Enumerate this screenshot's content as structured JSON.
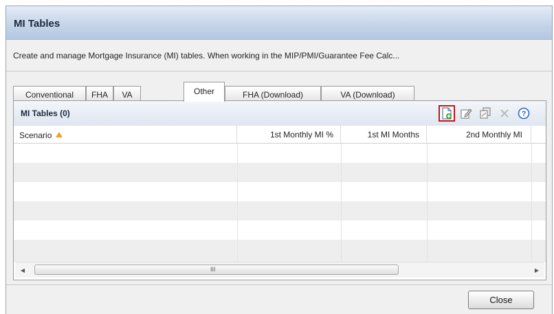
{
  "window": {
    "title": "MI Tables",
    "description": "Create and manage Mortgage Insurance (MI) tables. When working in the MIP/PMI/Guarantee Fee Calc..."
  },
  "tabs": [
    {
      "label": "Conventional",
      "active": false
    },
    {
      "label": "FHA",
      "active": false
    },
    {
      "label": "VA",
      "active": false
    },
    {
      "label": "Other",
      "active": true
    },
    {
      "label": "FHA (Download)",
      "active": false
    },
    {
      "label": "VA (Download)",
      "active": false
    }
  ],
  "panel": {
    "title": "MI Tables (0)",
    "toolbar": [
      {
        "name": "new-icon",
        "highlighted": true
      },
      {
        "name": "edit-icon",
        "highlighted": false
      },
      {
        "name": "duplicate-icon",
        "highlighted": false
      },
      {
        "name": "delete-icon",
        "highlighted": false,
        "disabled": true
      },
      {
        "name": "help-icon",
        "highlighted": false
      }
    ]
  },
  "grid": {
    "columns": [
      "Scenario",
      "1st Monthly MI %",
      "1st MI Months",
      "2nd Monthly MI"
    ],
    "sort": {
      "column": "Scenario",
      "direction": "ascending"
    },
    "rows": []
  },
  "scrollbar": {
    "grip": "III"
  },
  "footer": {
    "close_label": "Close"
  },
  "colors": {
    "accent": "#c1121f",
    "title_bar": "#c8d7ea",
    "sort_arrow": "#f0a020",
    "help": "#2b6cc4"
  }
}
